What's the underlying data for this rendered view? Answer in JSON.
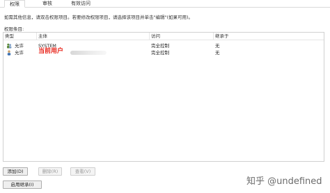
{
  "tabs": [
    "权限",
    "审核",
    "有效访问"
  ],
  "info_text": "如需其他信息，请双击权限项目。若要修改权限项目，请选择该项目并单击\"编辑\"(如果可用)。",
  "entries_label": "权限条目:",
  "columns": {
    "type": "类型",
    "principal": "主体",
    "access": "访问",
    "inherited_from": "继承于"
  },
  "rows": [
    {
      "icon": "users-icon",
      "type": "允许",
      "principal": "SYSTEM",
      "access": "完全控制",
      "inherited_from": "无"
    },
    {
      "icon": "user-icon",
      "type": "允许",
      "principal": "当前用户",
      "access": "完全控制",
      "inherited_from": "无"
    }
  ],
  "buttons": {
    "add": "添加(D)",
    "delete": "删除(R)",
    "view": "查看(V)",
    "enable_inheritance": "启用继承(I)"
  },
  "watermark": "知乎 @undefined",
  "colors": {
    "highlight": "#e8261c",
    "border": "#d0d0d0"
  }
}
